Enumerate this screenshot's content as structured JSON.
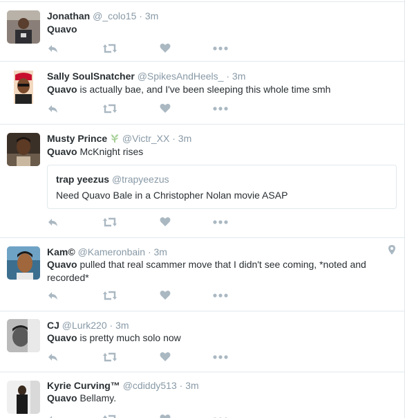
{
  "colors": {
    "action_icon": "#aab8c2",
    "username": "#8899a6",
    "border": "#e1e8ed",
    "text": "#292f33"
  },
  "tweets": [
    {
      "name": "Jonathan",
      "handle": "@_colo15",
      "sep": "·",
      "time": "3m",
      "keyword": "Quavo",
      "rest": "",
      "avatar_icon": "avatar-photo"
    },
    {
      "name": "Sally SoulSnatcher",
      "handle": "@SpikesAndHeels_",
      "sep": "·",
      "time": "3m",
      "keyword": "Quavo",
      "rest": " is actually bae, and I've been sleeping this whole time smh",
      "avatar_icon": "avatar-photo"
    },
    {
      "name": "Musty Prince",
      "badge_icon": "plant-emoji-icon",
      "handle": "@Victr_XX",
      "sep": "·",
      "time": "3m",
      "keyword": "Quavo",
      "rest": " McKnight rises",
      "avatar_icon": "avatar-photo",
      "quote": {
        "name": "trap yeezus",
        "handle": "@trapyeezus",
        "text": "Need Quavo Bale in a Christopher Nolan movie ASAP"
      }
    },
    {
      "name": "Kam©",
      "handle": "@Kameronbain",
      "sep": "·",
      "time": "3m",
      "keyword": "Quavo",
      "rest": " pulled that real scammer move that I didn't see coming, *noted and recorded*",
      "avatar_icon": "avatar-photo",
      "location_icon": "geo-pin-icon"
    },
    {
      "name": "CJ",
      "handle": "@Lurk220",
      "sep": "·",
      "time": "3m",
      "keyword": "Quavo",
      "rest": " is pretty much solo now",
      "avatar_icon": "avatar-photo"
    },
    {
      "name": "Kyrie Curving™",
      "handle": "@cdiddy513",
      "sep": "·",
      "time": "3m",
      "keyword": "Quavo",
      "rest": " Bellamy.",
      "avatar_icon": "avatar-photo"
    }
  ],
  "actions": [
    "reply-icon",
    "retweet-icon",
    "like-icon",
    "more-icon"
  ]
}
